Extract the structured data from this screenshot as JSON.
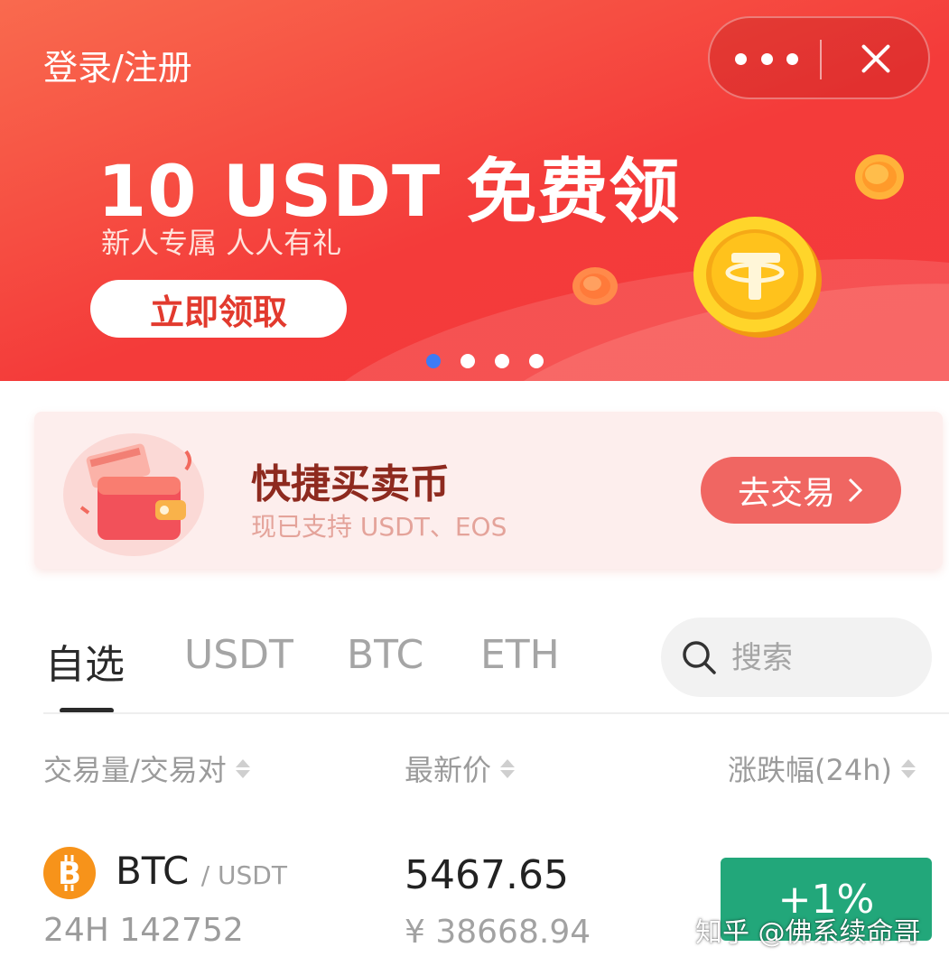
{
  "banner": {
    "login_link": "登录/注册",
    "headline": "10 USDT 免费领",
    "subline": "新人专属  人人有礼",
    "claim_button": "立即领取",
    "carousel_active_index": 0,
    "carousel_count": 4,
    "colors": {
      "background": "#f43b3a",
      "active_dot": "#3d7bf5"
    }
  },
  "capsule": {
    "more_icon": "more-dots-icon",
    "close_icon": "close-icon"
  },
  "quick_trade": {
    "title": "快捷买卖币",
    "subtitle": "现已支持 USDT、EOS",
    "button_label": "去交易",
    "button_icon": "chevron-right-icon"
  },
  "tabs": [
    {
      "label": "自选",
      "active": true
    },
    {
      "label": "USDT",
      "active": false
    },
    {
      "label": "BTC",
      "active": false
    },
    {
      "label": "ETH",
      "active": false
    }
  ],
  "search": {
    "placeholder": "搜索",
    "icon": "search-icon"
  },
  "columns": {
    "pair": "交易量/交易对",
    "price": "最新价",
    "change": "涨跌幅(24h)"
  },
  "market_rows": [
    {
      "base": "BTC",
      "quote": "/ USDT",
      "volume": "24H 142752",
      "price": "5467.65",
      "price_cny": "¥ 38668.94",
      "change": "+1%",
      "change_color": "#22a77a",
      "icon": "bitcoin-icon"
    }
  ],
  "watermark": "知乎 @佛系续命哥"
}
